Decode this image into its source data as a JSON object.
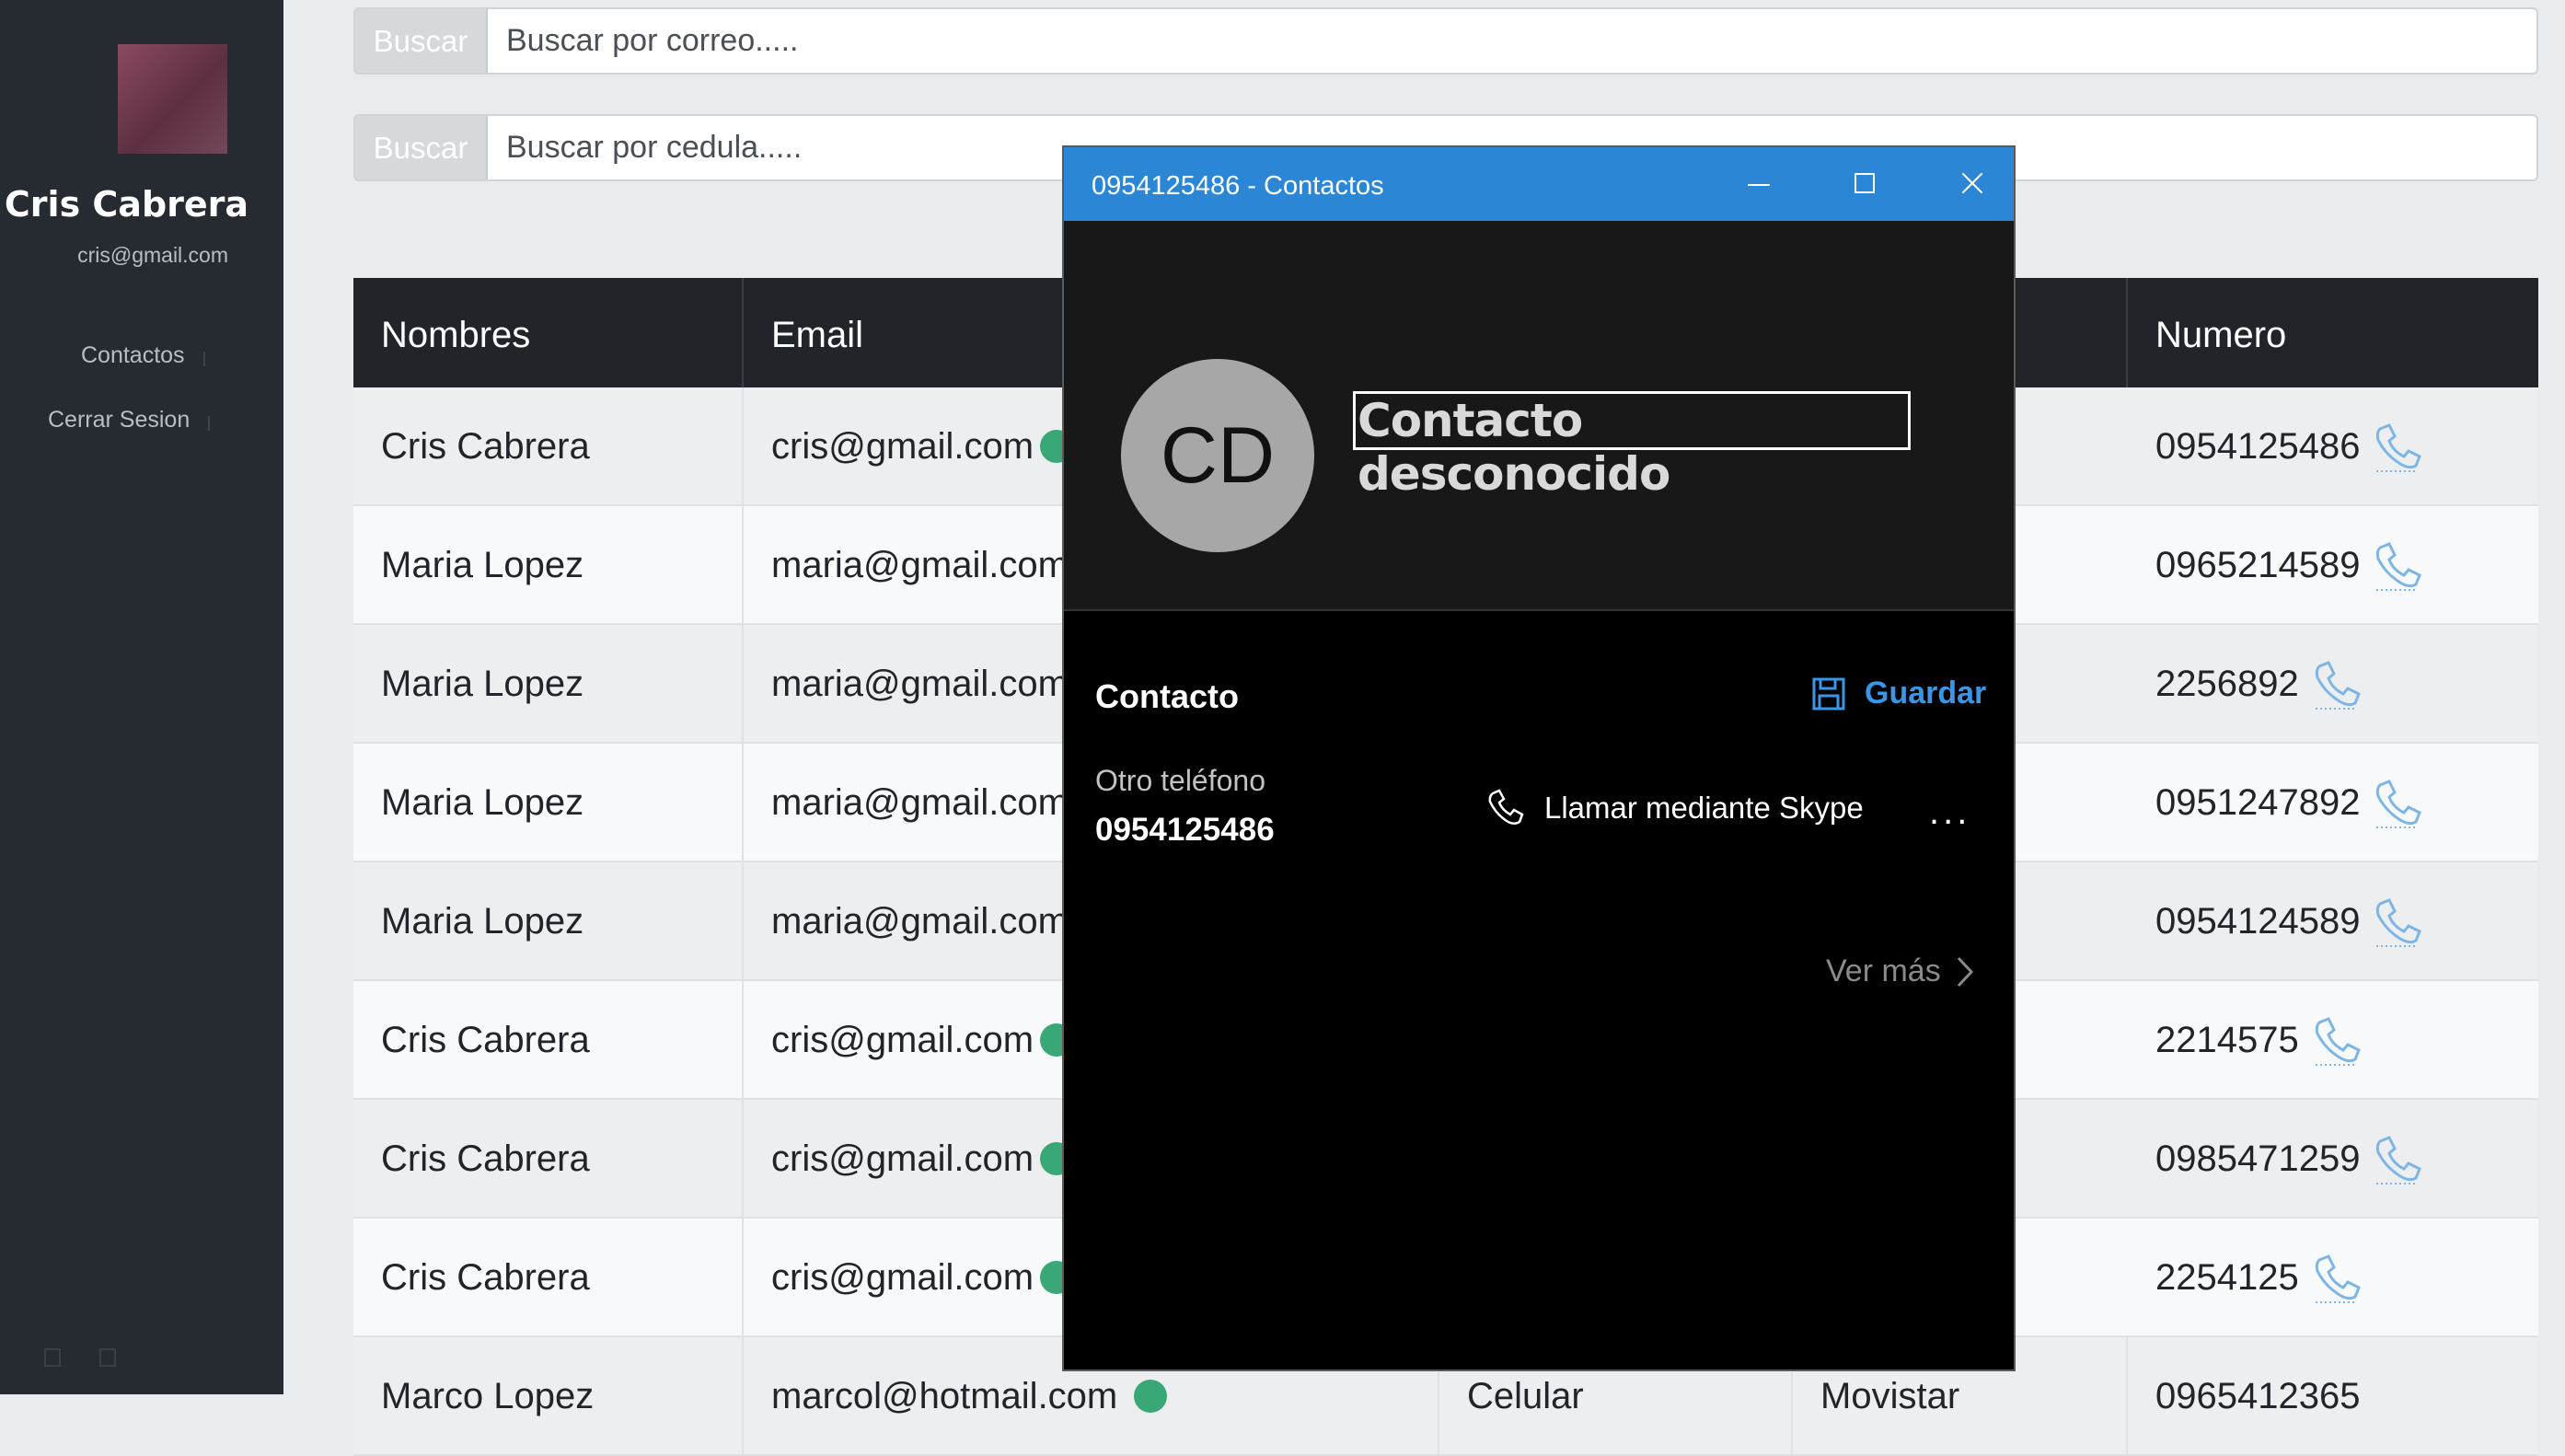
{
  "sidebar": {
    "user_name": "Cris Cabrera",
    "user_email": "cris@gmail.com",
    "nav": [
      {
        "label": "Contactos"
      },
      {
        "label": "Cerrar Sesion"
      }
    ]
  },
  "search_email": {
    "button": "Buscar",
    "placeholder": "Buscar por correo....."
  },
  "search_cedula": {
    "button": "Buscar",
    "placeholder": "Buscar por cedula....."
  },
  "table": {
    "headers": {
      "names": "Nombres",
      "email": "Email",
      "number": "Numero"
    },
    "rows": [
      {
        "name": "Cris Cabrera",
        "email": "cris@gmail.com",
        "number": "0954125486"
      },
      {
        "name": "Maria Lopez",
        "email": "maria@gmail.com",
        "number": "0965214589"
      },
      {
        "name": "Maria Lopez",
        "email": "maria@gmail.com",
        "number": "2256892"
      },
      {
        "name": "Maria Lopez",
        "email": "maria@gmail.com",
        "number": "0951247892"
      },
      {
        "name": "Maria Lopez",
        "email": "maria@gmail.com",
        "number": "0954124589"
      },
      {
        "name": "Cris Cabrera",
        "email": "cris@gmail.com",
        "number": "2214575"
      },
      {
        "name": "Cris Cabrera",
        "email": "cris@gmail.com",
        "number": "0985471259"
      },
      {
        "name": "Cris Cabrera",
        "email": "cris@gmail.com",
        "number": "2254125"
      },
      {
        "name": "Marco Lopez",
        "email": "marcol@hotmail.com",
        "type": "Celular",
        "carrier": "Movistar",
        "number": "0965412365"
      }
    ]
  },
  "contact_window": {
    "title": "0954125486 - Contactos",
    "initials": "CD",
    "name": "Contacto desconocido",
    "section_title": "Contacto",
    "save_label": "Guardar",
    "phone_label": "Otro teléfono",
    "phone_number": "0954125486",
    "skype_label": "Llamar mediante Skype",
    "more_label": "...",
    "see_more": "Ver más"
  },
  "colors": {
    "accent": "#2b86d6",
    "link": "#3a96e6",
    "header": "#212529",
    "sidebar": "#262b31"
  }
}
